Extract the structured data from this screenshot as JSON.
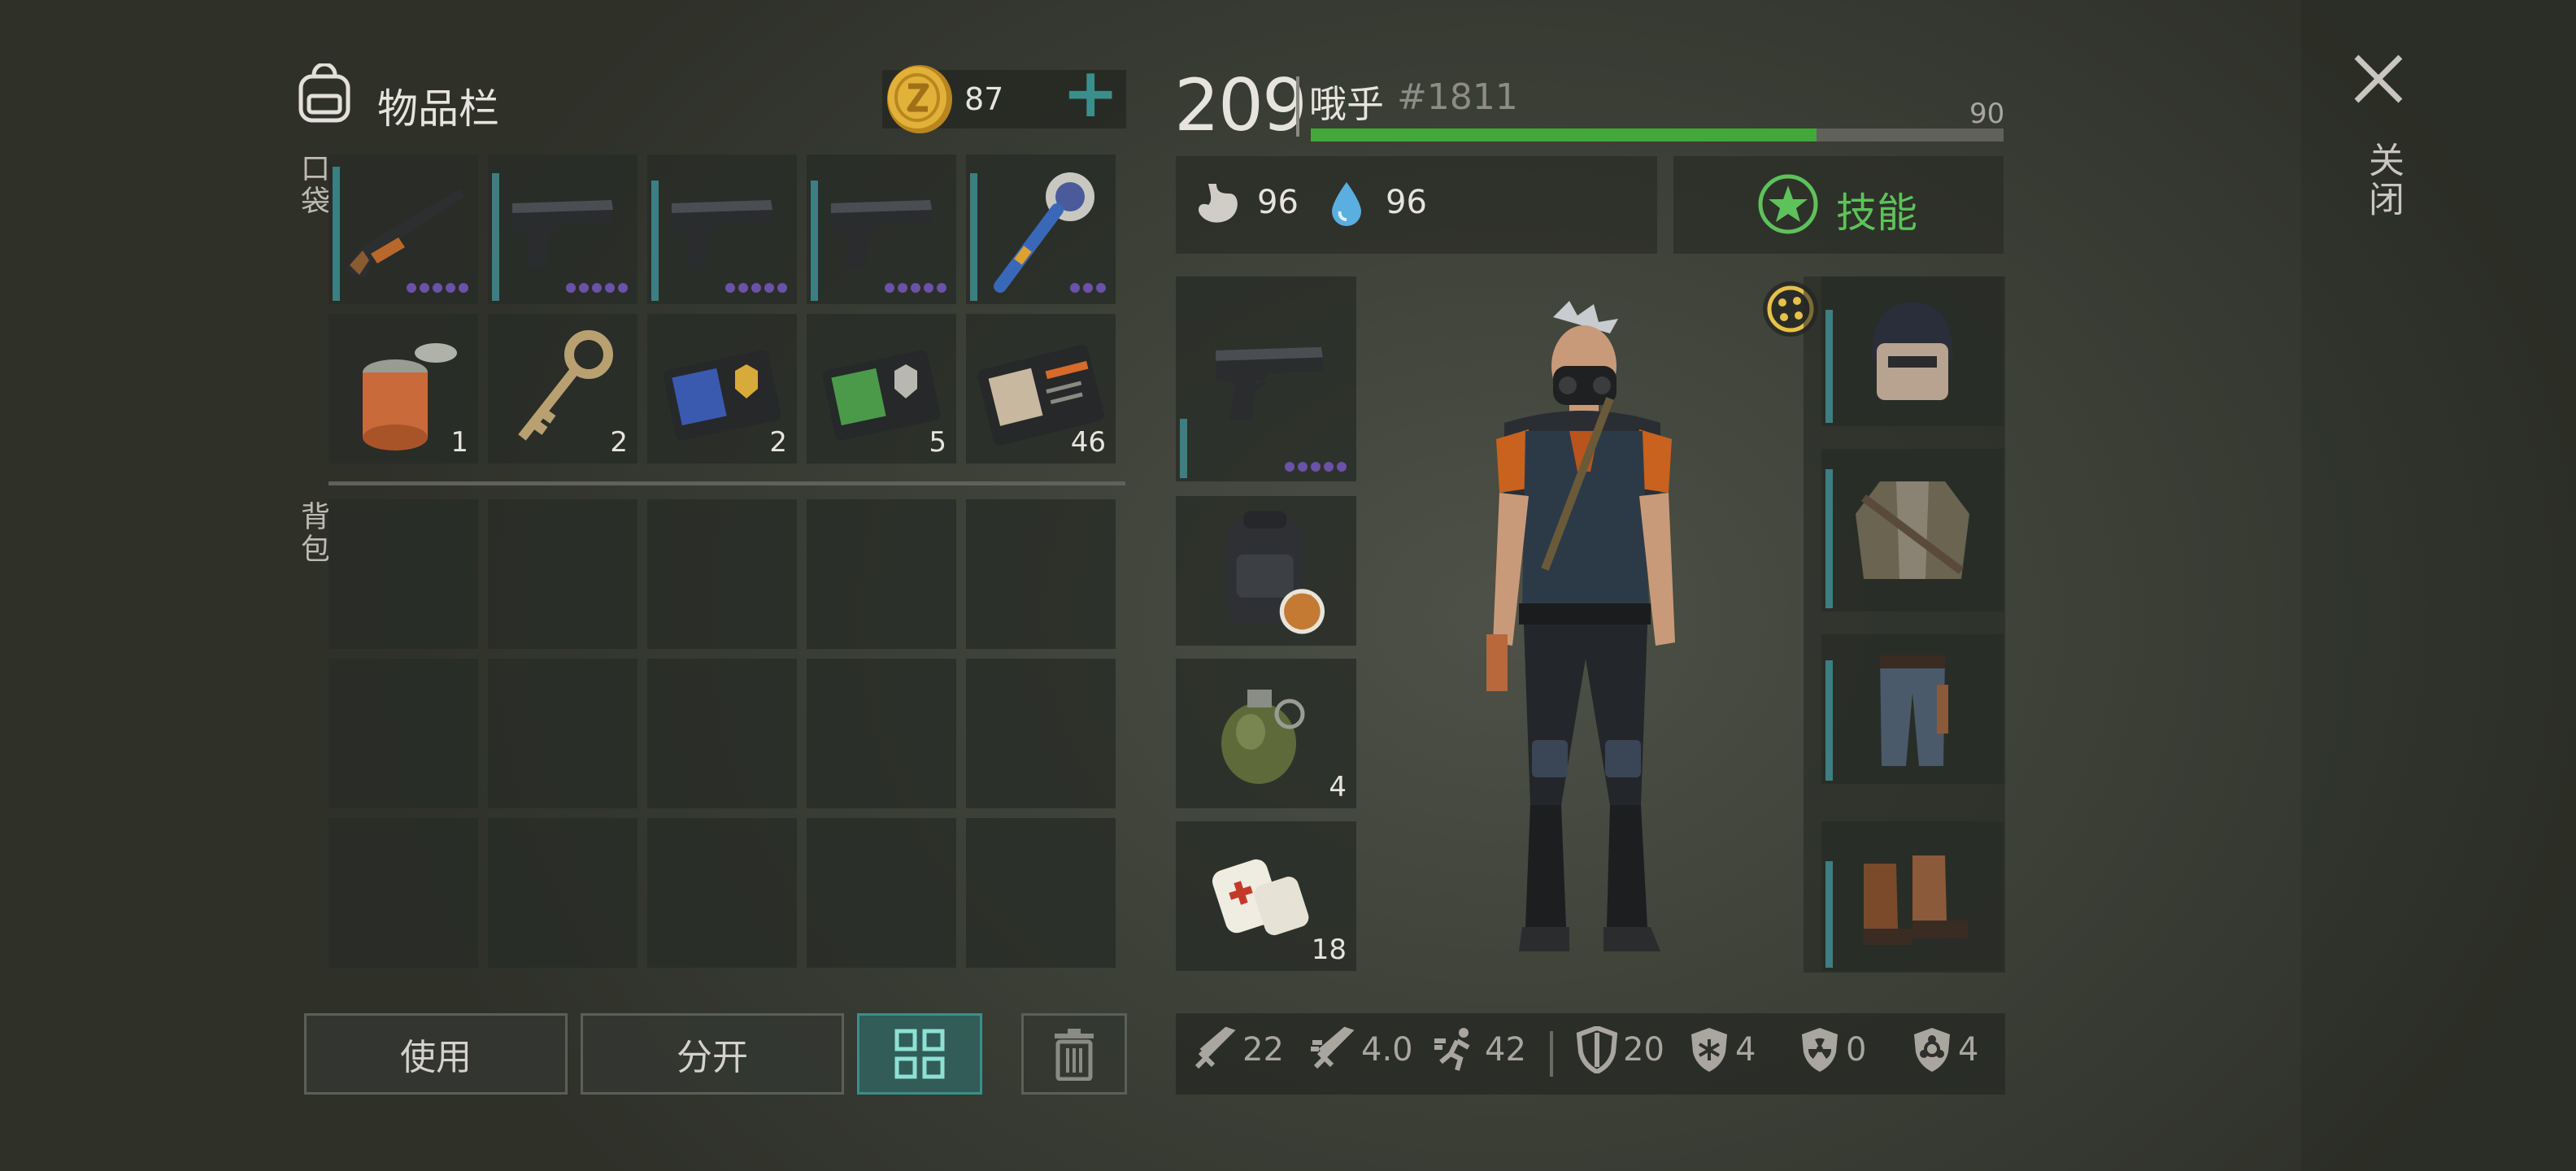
{
  "inventory": {
    "title": "物品栏",
    "coins": "87",
    "add_label": "+"
  },
  "sections": {
    "pockets": "口袋",
    "backpack": "背包"
  },
  "pockets": {
    "weapons": [
      {
        "icon": "shotgun-icon",
        "durability": 0.95,
        "dots": 5
      },
      {
        "icon": "pistol-icon",
        "durability": 0.9,
        "dots": 5
      },
      {
        "icon": "pistol-icon",
        "durability": 0.85,
        "dots": 5
      },
      {
        "icon": "pistol-icon",
        "durability": 0.85,
        "dots": 5
      },
      {
        "icon": "spiked-club-icon",
        "durability": 0.9,
        "dots": 3
      }
    ],
    "items": [
      {
        "icon": "tin-can-icon",
        "count": "1"
      },
      {
        "icon": "key-icon",
        "count": "2"
      },
      {
        "icon": "blue-badge-wallet-icon",
        "count": "2"
      },
      {
        "icon": "green-badge-wallet-icon",
        "count": "5"
      },
      {
        "icon": "patrol-officer-card-icon",
        "count": "46"
      }
    ]
  },
  "actions": {
    "use": "使用",
    "split": "分开"
  },
  "player": {
    "level": "209",
    "name": "哦乎",
    "tag": "#1811",
    "xp_next": "90",
    "xp_progress": 0.73
  },
  "vitals": {
    "food": "96",
    "water": "96"
  },
  "skills": {
    "label": "技能"
  },
  "equipment": {
    "weapon": {
      "icon": "pistol-icon",
      "durability": 0.3
    },
    "backpack": {
      "icon": "backpack-icon"
    },
    "grenade": {
      "icon": "grenade-icon",
      "count": "4"
    },
    "bandage": {
      "icon": "bandage-icon",
      "count": "18"
    },
    "armor": [
      {
        "icon": "helmet-icon",
        "durability": 0.8
      },
      {
        "icon": "jacket-icon",
        "durability": 0.9
      },
      {
        "icon": "pants-icon",
        "durability": 0.85
      },
      {
        "icon": "boots-icon",
        "durability": 0.75
      }
    ]
  },
  "stats": {
    "damage": "22",
    "attack_speed": "4.0",
    "move_speed": "42",
    "defense": "20",
    "cold_resist": "4",
    "radiation_resist": "0",
    "toxic_resist": "4"
  },
  "close": {
    "label": "关闭",
    "icon": "close-icon"
  },
  "colors": {
    "accent": "#3a8f8b",
    "xp": "#43a83a",
    "skill": "#5ec25a",
    "coin": "#d8a832",
    "durability_dot": "#6a52a8"
  }
}
